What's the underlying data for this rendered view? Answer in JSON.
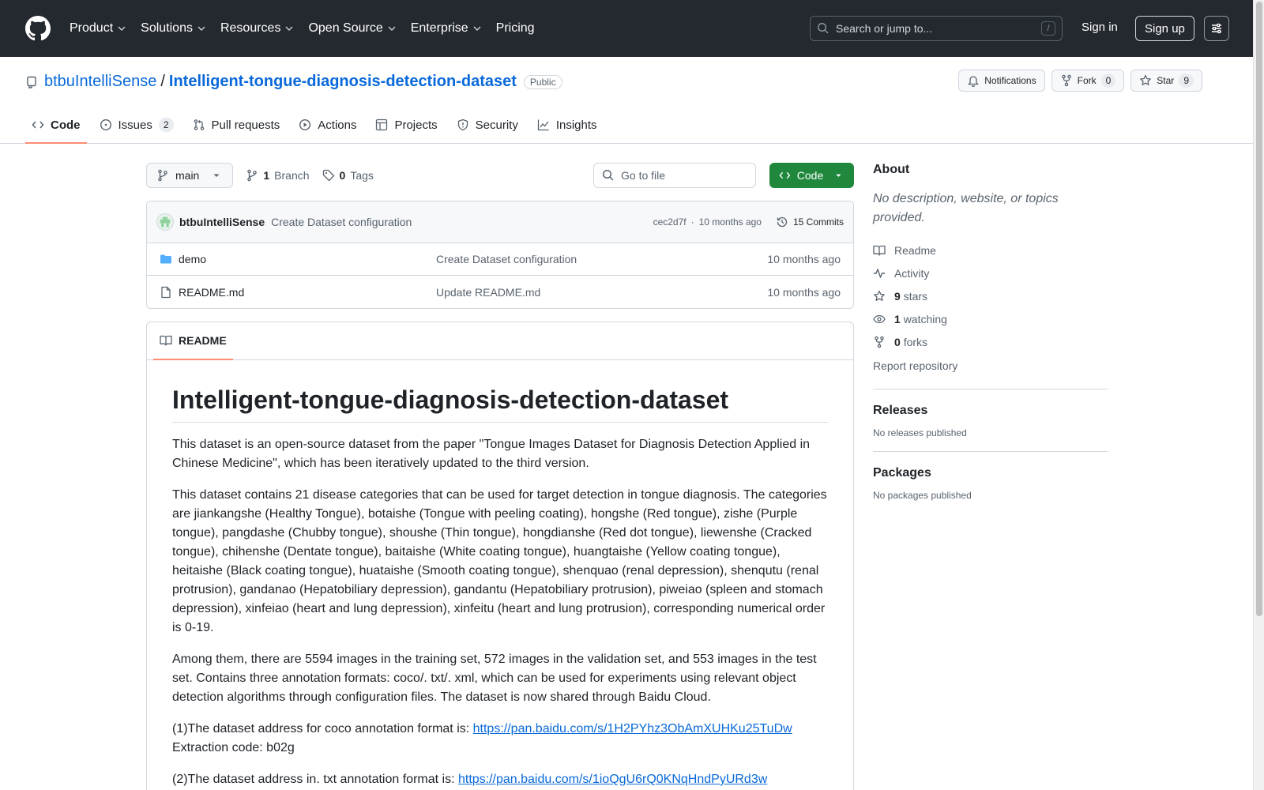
{
  "header": {
    "nav": [
      "Product",
      "Solutions",
      "Resources",
      "Open Source",
      "Enterprise",
      "Pricing"
    ],
    "search_placeholder": "Search or jump to...",
    "search_shortcut": "/",
    "signin": "Sign in",
    "signup": "Sign up"
  },
  "repo": {
    "owner": "btbuIntelliSense",
    "separator": "/",
    "name": "Intelligent-tongue-diagnosis-detection-dataset",
    "visibility": "Public",
    "notifications": "Notifications",
    "fork_label": "Fork",
    "fork_count": "0",
    "star_label": "Star",
    "star_count": "9"
  },
  "tabs": [
    {
      "label": "Code",
      "icon": "code-icon",
      "active": true
    },
    {
      "label": "Issues",
      "icon": "issue-icon",
      "count": "2"
    },
    {
      "label": "Pull requests",
      "icon": "pull-request-icon"
    },
    {
      "label": "Actions",
      "icon": "play-icon"
    },
    {
      "label": "Projects",
      "icon": "table-icon"
    },
    {
      "label": "Security",
      "icon": "shield-icon"
    },
    {
      "label": "Insights",
      "icon": "graph-icon"
    }
  ],
  "toolbar": {
    "branch": "main",
    "branch_count": "1",
    "branch_label": "Branch",
    "tag_count": "0",
    "tag_label": "Tags",
    "goto_placeholder": "Go to file",
    "code_button": "Code"
  },
  "commit": {
    "author": "btbuIntelliSense",
    "message": "Create Dataset configuration",
    "hash": "cec2d7f",
    "dot": "·",
    "time": "10 months ago",
    "commits": "15 Commits"
  },
  "files": [
    {
      "type": "folder",
      "name": "demo",
      "message": "Create Dataset configuration",
      "time": "10 months ago"
    },
    {
      "type": "file",
      "name": "README.md",
      "message": "Update README.md",
      "time": "10 months ago"
    }
  ],
  "readme": {
    "tab": "README",
    "title": "Intelligent-tongue-diagnosis-detection-dataset",
    "p1": "This dataset is an open-source dataset from the paper \"Tongue Images Dataset for Diagnosis Detection Applied in Chinese Medicine\", which has been iteratively updated to the third version.",
    "p2": "This dataset contains 21 disease categories that can be used for target detection in tongue diagnosis. The categories are jiankangshe (Healthy Tongue), botaishe (Tongue with peeling coating), hongshe (Red tongue), zishe (Purple tongue), pangdashe (Chubby tongue), shoushe (Thin tongue), hongdianshe (Red dot tongue), liewenshe (Cracked tongue), chihenshe (Dentate tongue), baitaishe (White coating tongue), huangtaishe (Yellow coating tongue), heitaishe (Black coating tongue), huataishe (Smooth coating tongue), shenquao (renal depression), shenqutu (renal protrusion), gandanao (Hepatobiliary depression), gandantu (Hepatobiliary protrusion), piweiao (spleen and stomach depression), xinfeiao (heart and lung depression), xinfeitu (heart and lung protrusion), corresponding numerical order is 0-19.",
    "p3": "Among them, there are 5594 images in the training set, 572 images in the validation set, and 553 images in the test set. Contains three annotation formats: coco/. txt/. xml, which can be used for experiments using relevant object detection algorithms through configuration files. The dataset is now shared through Baidu Cloud.",
    "p4_prefix": "(1)The dataset address for coco annotation format is: ",
    "p4_link": "https://pan.baidu.com/s/1H2PYhz3ObAmXUHKu25TuDw",
    "p4_code": "Extraction code: b02g",
    "p5_prefix": "(2)The dataset address in. txt annotation format is: ",
    "p5_link": "https://pan.baidu.com/s/1ioQgU6rQ0KNqHndPyURd3w"
  },
  "about": {
    "title": "About",
    "description": "No description, website, or topics provided.",
    "readme": "Readme",
    "activity": "Activity",
    "stars_count": "9",
    "stars_label": "stars",
    "watching_count": "1",
    "watching_label": "watching",
    "forks_count": "0",
    "forks_label": "forks",
    "report": "Report repository"
  },
  "releases": {
    "title": "Releases",
    "empty": "No releases published"
  },
  "packages": {
    "title": "Packages",
    "empty": "No packages published"
  },
  "colors": {
    "header_bg": "#24292f",
    "link": "#0969da",
    "primary_green": "#1f883d",
    "tab_underline": "#fd8c73"
  }
}
